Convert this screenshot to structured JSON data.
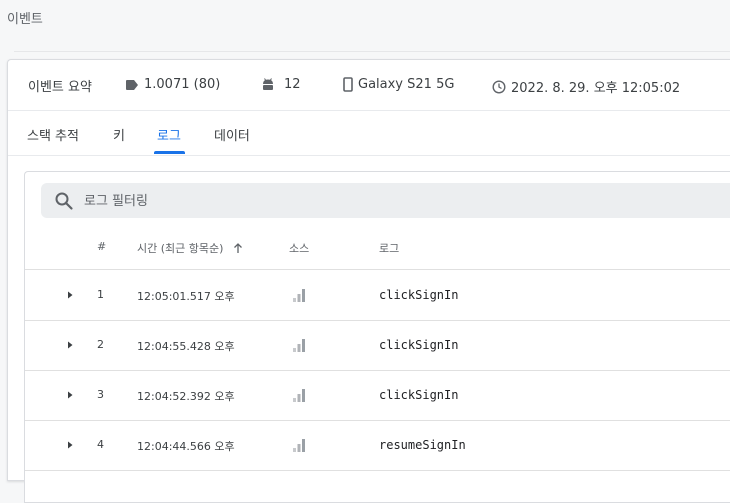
{
  "page": {
    "title": "이벤트"
  },
  "summary": {
    "title": "이벤트 요약",
    "version": "1.0071 (80)",
    "os_version": "12",
    "device": "Galaxy S21 5G",
    "timestamp": "2022. 8. 29. 오후 12:05:02"
  },
  "tabs": [
    {
      "label": "스택 추적"
    },
    {
      "label": "키"
    },
    {
      "label": "로그",
      "active": true
    },
    {
      "label": "데이터"
    }
  ],
  "filter": {
    "placeholder": "로그 필터링",
    "value": ""
  },
  "table": {
    "columns": {
      "num": "#",
      "time": "시간 (최근 항목순)",
      "source": "소스",
      "log": "로그"
    },
    "rows": [
      {
        "num": "1",
        "time": "12:05:01.517 오후",
        "log": "clickSignIn"
      },
      {
        "num": "2",
        "time": "12:04:55.428 오후",
        "log": "clickSignIn"
      },
      {
        "num": "3",
        "time": "12:04:52.392 오후",
        "log": "clickSignIn"
      },
      {
        "num": "4",
        "time": "12:04:44.566 오후",
        "log": "resumeSignIn"
      }
    ]
  },
  "icons": {
    "version": "label-icon",
    "os": "android-icon",
    "device": "phone-icon",
    "time": "clock-icon",
    "search": "search-icon",
    "sort": "arrow-up-icon",
    "expand": "triangle-right-icon",
    "source": "signal-bars-icon"
  },
  "colors": {
    "accent": "#1a73e8",
    "muted_icon": "#9aa0a6"
  }
}
